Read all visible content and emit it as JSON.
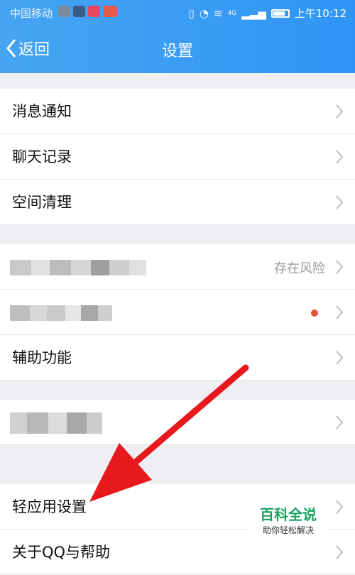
{
  "status_bar": {
    "carrier": "中国移动",
    "time": "上午10:12",
    "network": "4G",
    "indicator_colors": [
      "#7a8a9c",
      "#3b5a84",
      "#e8475b",
      "#e85a4a"
    ]
  },
  "header": {
    "back_label": "返回",
    "title": "设置",
    "background": "#3a9cf4"
  },
  "sections": [
    {
      "items": [
        {
          "label": "消息通知"
        },
        {
          "label": "聊天记录"
        },
        {
          "label": "空间清理"
        }
      ]
    },
    {
      "items": [
        {
          "label": "",
          "hint": "存在风险",
          "blurred": true
        },
        {
          "label": "",
          "blurred": true,
          "has_dot": true
        },
        {
          "label": "辅助功能"
        }
      ]
    },
    {
      "items": [
        {
          "label": "",
          "blurred": true
        }
      ]
    },
    {
      "items": [
        {
          "label": "轻应用设置"
        },
        {
          "label": "关于QQ与帮助"
        }
      ]
    }
  ],
  "annotation_arrow_color": "#e8191c",
  "watermark": {
    "title": "百科全说",
    "subtitle": "助你轻松解决",
    "color": "#1aa260"
  }
}
